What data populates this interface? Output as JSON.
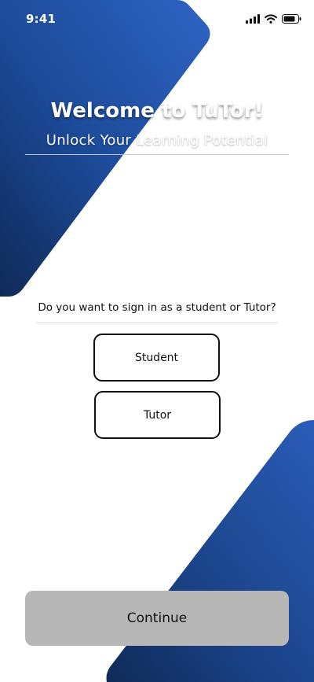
{
  "status_bar": {
    "time": "9:41",
    "icons": [
      "signal-icon",
      "wifi-icon",
      "battery-icon"
    ]
  },
  "hero": {
    "title": "Welcome to TuTor!",
    "subtitle": "Unlock Your Learning Potential"
  },
  "role_prompt": {
    "question": "Do you want to sign in as a student or Tutor?",
    "options": [
      "Student",
      "Tutor"
    ]
  },
  "actions": {
    "continue_label": "Continue"
  },
  "colors": {
    "gradient_light": "#2e64c3",
    "gradient_dark": "#0f2a57",
    "continue_bg": "#b7b7b7",
    "button_border": "#111111"
  }
}
